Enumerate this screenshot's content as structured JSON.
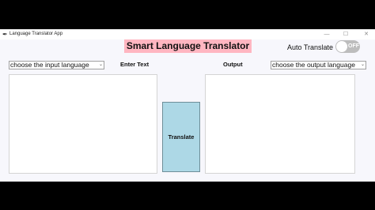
{
  "window": {
    "title": "Language Translator App",
    "app_icon": "feather-icon",
    "controls": [
      "—",
      "☐",
      "✕"
    ]
  },
  "header": {
    "title": "Smart Language Translator",
    "title_bg": "#ffb6c1",
    "auto_translate_label": "Auto Translate",
    "toggle_state": "OFF"
  },
  "input": {
    "language_select": "choose the input language",
    "label": "Enter Text",
    "text": ""
  },
  "output": {
    "label": "Output",
    "language_select": "choose the output language",
    "text": ""
  },
  "actions": {
    "translate_label": "Translate",
    "translate_bg": "#add8e6"
  }
}
